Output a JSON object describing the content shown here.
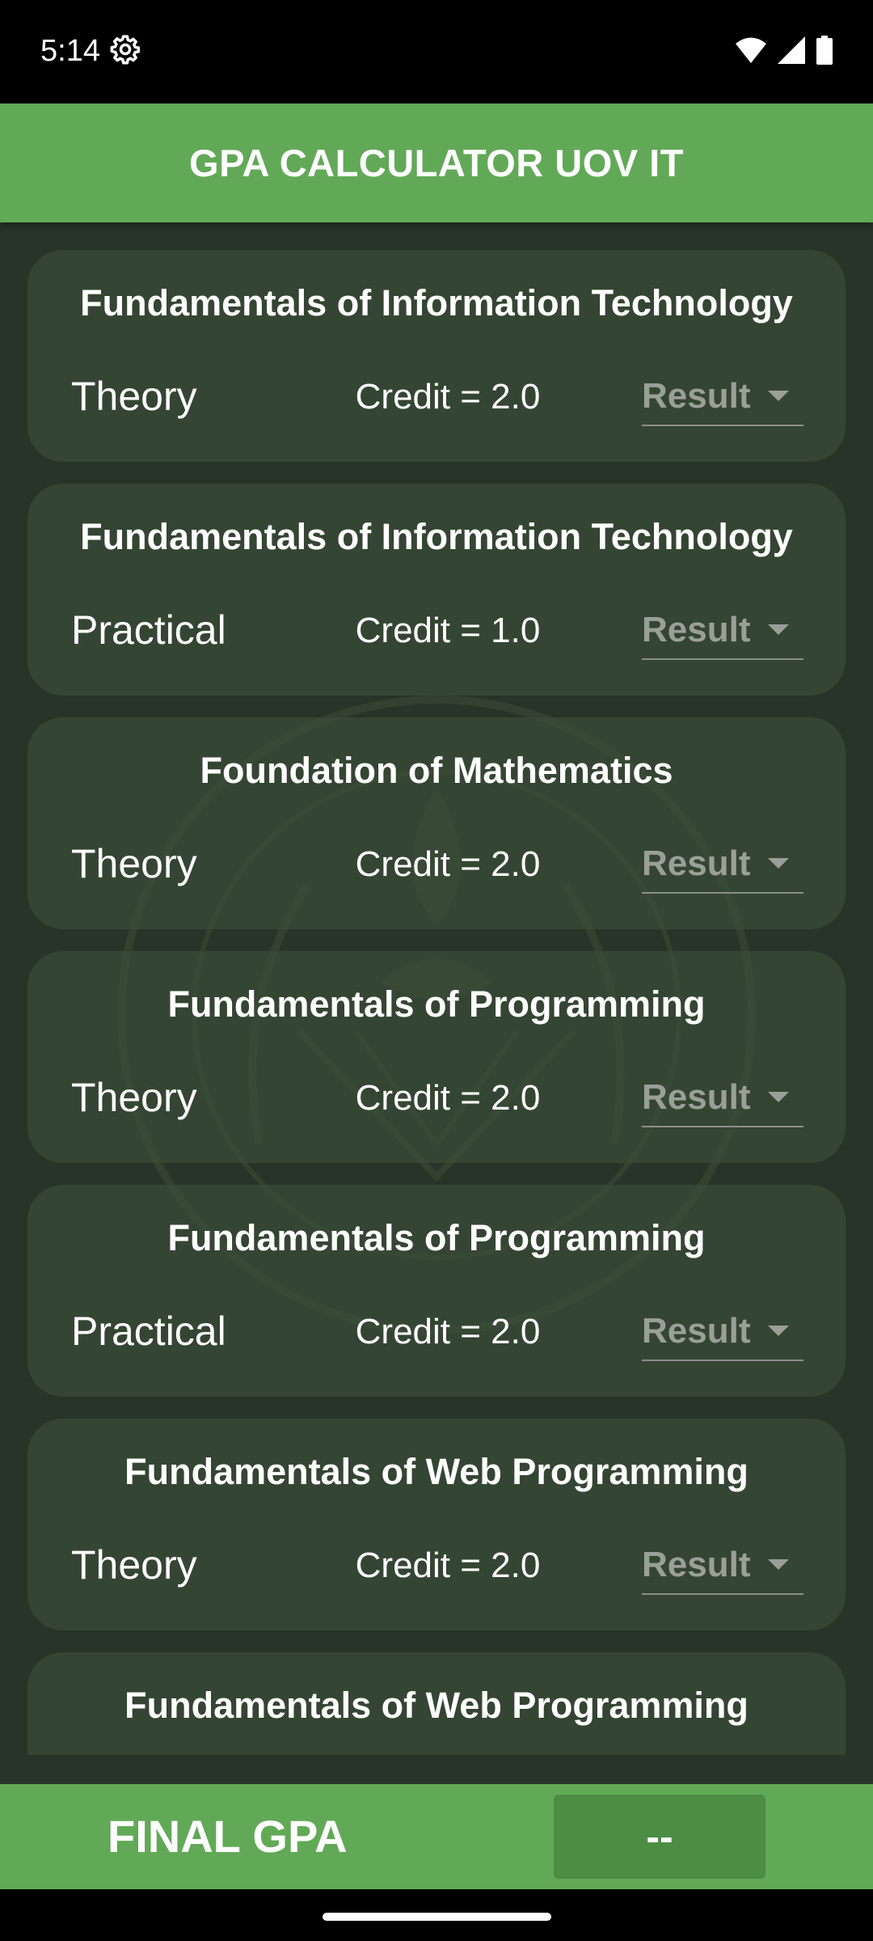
{
  "status_bar": {
    "time": "5:14"
  },
  "app_bar": {
    "title": "GPA CALCULATOR UOV IT"
  },
  "courses": [
    {
      "title": "Fundamentals of Information Technology",
      "type": "Theory",
      "credit": "Credit = 2.0",
      "result": "Result"
    },
    {
      "title": "Fundamentals of Information Technology",
      "type": "Practical",
      "credit": "Credit = 1.0",
      "result": "Result"
    },
    {
      "title": "Foundation of Mathematics",
      "type": "Theory",
      "credit": "Credit = 2.0",
      "result": "Result"
    },
    {
      "title": "Fundamentals of Programming",
      "type": "Theory",
      "credit": "Credit = 2.0",
      "result": "Result"
    },
    {
      "title": "Fundamentals of Programming",
      "type": "Practical",
      "credit": "Credit = 2.0",
      "result": "Result"
    },
    {
      "title": "Fundamentals of Web Programming",
      "type": "Theory",
      "credit": "Credit = 2.0",
      "result": "Result"
    },
    {
      "title": "Fundamentals of Web Programming",
      "type": "",
      "credit": "",
      "result": ""
    }
  ],
  "footer": {
    "final_label": "FINAL GPA",
    "gpa_value": "--"
  },
  "colors": {
    "accent_green": "#62a957",
    "gpa_box": "#4c8d44",
    "background": "#283428",
    "card": "#3a4c38"
  }
}
